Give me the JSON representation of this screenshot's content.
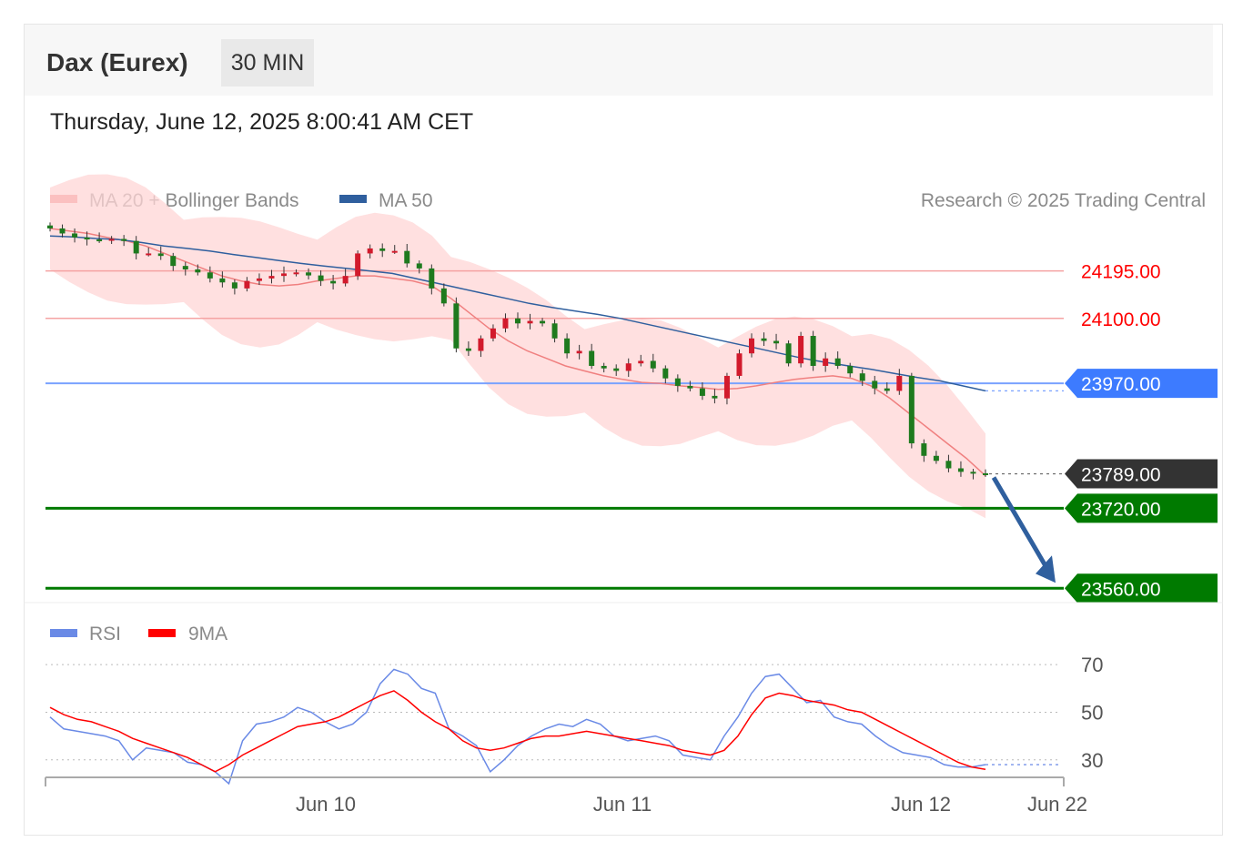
{
  "header": {
    "instrument": "Dax (Eurex)",
    "timeframe": "30 MIN",
    "datetime": "Thursday, June 12, 2025 8:00:41 AM CET"
  },
  "legend": {
    "ma20_label": "MA 20 + Bollinger Bands",
    "ma50_label": "MA 50",
    "copyright": "Research © 2025 Trading Central",
    "rsi_label": "RSI",
    "rsi_ma_label": "9MA"
  },
  "colors": {
    "ma20": "#f08080",
    "ma50": "#2f5f9e",
    "bollinger_fill": "#ffd6d6",
    "resistance": "#ff0000",
    "pivot": "#3d7bff",
    "support": "#007a00",
    "last_price": "#333333",
    "candle_up": "#d21a2c",
    "candle_down": "#1e7a1e",
    "rsi": "#6a8ae6",
    "rsi_ma": "#ff0000",
    "arrow": "#2f5f9e"
  },
  "chart_data": [
    {
      "type": "candlestick",
      "ylim": [
        23535,
        24300
      ],
      "x_ticks": [
        "Jun 10",
        "Jun 11",
        "Jun 12",
        "Jun 22"
      ],
      "levels": [
        {
          "kind": "resistance",
          "value": 24195.0,
          "label": "24195.00"
        },
        {
          "kind": "resistance",
          "value": 24100.0,
          "label": "24100.00"
        },
        {
          "kind": "pivot",
          "value": 23970.0,
          "label": "23970.00"
        },
        {
          "kind": "last",
          "value": 23789.0,
          "label": "23789.00"
        },
        {
          "kind": "support",
          "value": 23720.0,
          "label": "23720.00"
        },
        {
          "kind": "support",
          "value": 23560.0,
          "label": "23560.00"
        }
      ],
      "forecast_arrow": {
        "from": 23789,
        "to": 23560
      },
      "series": [
        {
          "name": "MA 20 + Bollinger Bands",
          "type": "line",
          "values": [
            24280,
            24275,
            24270,
            24262,
            24255,
            24245,
            24230,
            24215,
            24200,
            24185,
            24175,
            24168,
            24165,
            24168,
            24175,
            24180,
            24185,
            24185,
            24180,
            24175,
            24165,
            24140,
            24110,
            24080,
            24055,
            24035,
            24020,
            24005,
            23995,
            23985,
            23978,
            23972,
            23970,
            23965,
            23962,
            23958,
            23960,
            23965,
            23972,
            23978,
            23982,
            23985,
            23980,
            23965,
            23940,
            23910,
            23880,
            23850,
            23820,
            23785
          ]
        },
        {
          "name": "MA 50",
          "type": "line",
          "values": [
            24265,
            24263,
            24260,
            24258,
            24252,
            24245,
            24240,
            24235,
            24228,
            24222,
            24216,
            24210,
            24205,
            24200,
            24195,
            24190,
            24180,
            24170,
            24160,
            24150,
            24140,
            24130,
            24122,
            24115,
            24108,
            24100,
            24090,
            24080,
            24070,
            24060,
            24050,
            24040,
            24030,
            24020,
            24012,
            24005,
            23998,
            23990,
            23982,
            23975,
            23965,
            23955
          ]
        },
        {
          "name": "Candles",
          "type": "candlestick",
          "close_values": [
            24280,
            24270,
            24262,
            24258,
            24257,
            24259,
            24255,
            24230,
            24230,
            24225,
            24205,
            24198,
            24192,
            24180,
            24172,
            24160,
            24175,
            24180,
            24185,
            24190,
            24192,
            24186,
            24175,
            24170,
            24185,
            24230,
            24240,
            24235,
            24235,
            24210,
            24200,
            24160,
            24130,
            24040,
            24035,
            24060,
            24080,
            24100,
            24090,
            24095,
            24090,
            24060,
            24030,
            24035,
            24005,
            24000,
            23995,
            24010,
            24015,
            24000,
            23980,
            23965,
            23960,
            23945,
            23940,
            23985,
            24030,
            24060,
            24055,
            24050,
            24010,
            24065,
            24005,
            24020,
            24005,
            23990,
            23975,
            23960,
            23955,
            23985,
            23850,
            23825,
            23815,
            23800,
            23793,
            23790,
            23789
          ]
        }
      ]
    },
    {
      "type": "line",
      "ylim": [
        15,
        80
      ],
      "y_ticks": [
        70,
        50,
        30
      ],
      "series": [
        {
          "name": "RSI",
          "values": [
            48,
            43,
            42,
            41,
            40,
            38,
            30,
            35,
            34,
            33,
            29,
            28,
            25,
            20,
            38,
            45,
            46,
            48,
            52,
            50,
            46,
            43,
            45,
            50,
            62,
            68,
            66,
            60,
            58,
            43,
            40,
            36,
            25,
            30,
            36,
            40,
            43,
            45,
            44,
            47,
            45,
            40,
            38,
            39,
            40,
            38,
            32,
            31,
            30,
            40,
            48,
            58,
            65,
            66,
            60,
            54,
            55,
            48,
            46,
            45,
            40,
            36,
            33,
            32,
            31,
            28,
            27,
            27,
            28
          ]
        },
        {
          "name": "9MA",
          "values": [
            52,
            49,
            47,
            46,
            44,
            42,
            39,
            37,
            35,
            33,
            31,
            28,
            25,
            28,
            32,
            35,
            38,
            41,
            44,
            45,
            46,
            48,
            51,
            54,
            57,
            59,
            55,
            50,
            46,
            43,
            38,
            35,
            34,
            35,
            37,
            39,
            40,
            40,
            41,
            42,
            41,
            40,
            39,
            38,
            37,
            36,
            34,
            33,
            32,
            34,
            40,
            49,
            56,
            58,
            57,
            55,
            54,
            53,
            51,
            50,
            47,
            44,
            41,
            38,
            35,
            32,
            29,
            27,
            26
          ]
        }
      ]
    }
  ]
}
